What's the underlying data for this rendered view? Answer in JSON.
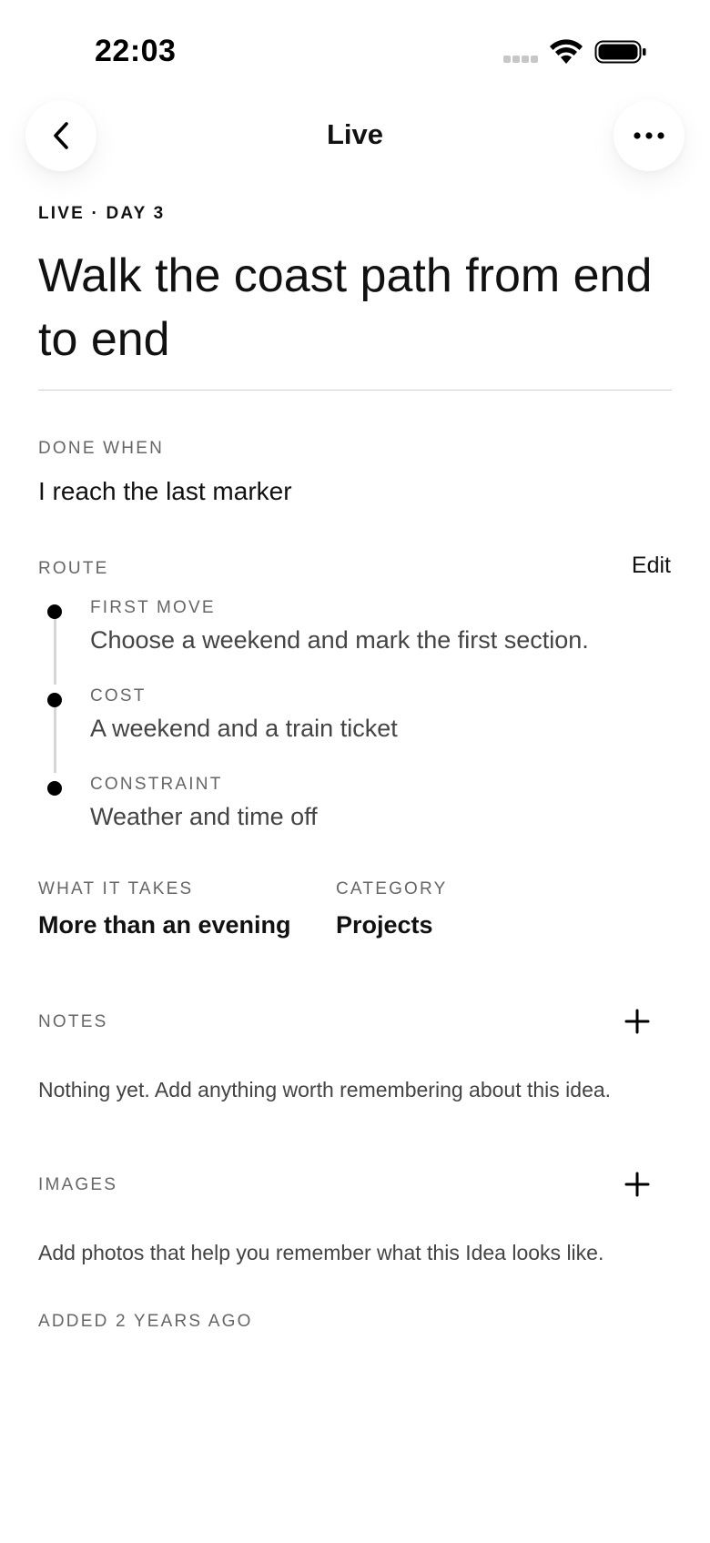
{
  "status_bar": {
    "time": "22:03"
  },
  "nav": {
    "title": "Live",
    "back_icon": "chevron-left-icon",
    "more_icon": "ellipsis-icon"
  },
  "header": {
    "eyebrow": "LIVE · DAY 3",
    "title": "Walk the coast path from end to end"
  },
  "done_when": {
    "label": "DONE WHEN",
    "value": "I reach the last marker"
  },
  "route": {
    "label": "ROUTE",
    "edit_label": "Edit",
    "steps": [
      {
        "label": "FIRST MOVE",
        "value": "Choose a weekend and mark the first section."
      },
      {
        "label": "COST",
        "value": "A weekend and a train ticket"
      },
      {
        "label": "CONSTRAINT",
        "value": "Weather and time off"
      }
    ]
  },
  "what_it_takes": {
    "label": "WHAT IT TAKES",
    "value": "More than an evening"
  },
  "category": {
    "label": "CATEGORY",
    "value": "Projects"
  },
  "notes": {
    "label": "NOTES",
    "empty_text": "Nothing yet. Add anything worth remembering about this idea.",
    "add_icon": "plus-icon"
  },
  "images": {
    "label": "IMAGES",
    "empty_text": "Add photos that help you remember what this Idea looks like.",
    "add_icon": "plus-icon"
  },
  "added": {
    "text": "ADDED 2 YEARS AGO"
  },
  "colors": {
    "text": "#111111",
    "muted": "#666666",
    "body": "#444444",
    "divider": "#cfcfcf",
    "timeline": "#d6d6d6"
  }
}
